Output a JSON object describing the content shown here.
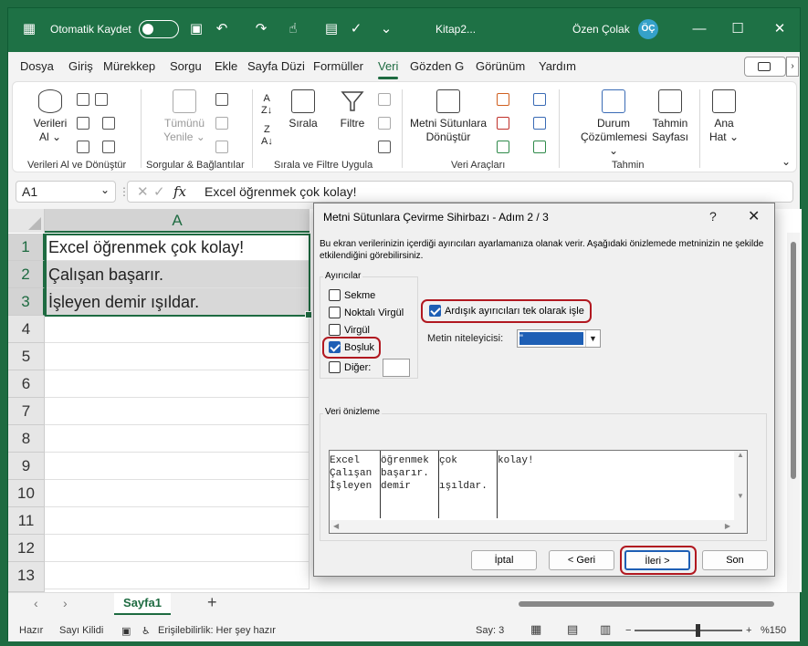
{
  "titlebar": {
    "autosave_label": "Otomatik Kaydet",
    "doc_title": "Kitap2...",
    "user_name": "Özen Çolak",
    "user_initials": "ÖÇ"
  },
  "menu": {
    "tabs": [
      "Dosya",
      "Giriş",
      "Mürekkep",
      "Sorgu",
      "Ekle",
      "Sayfa Düzi",
      "Formüller",
      "Veri",
      "Gözden G",
      "Görünüm",
      "Yardım"
    ],
    "active": "Veri"
  },
  "ribbon": {
    "get_data_label": "Verileri",
    "get_data_label2": "Al",
    "get_data_group": "Verileri Al ve Dönüştür",
    "refresh_label": "Tümünü",
    "refresh_label2": "Yenile",
    "queries_group": "Sorgular & Bağlantılar",
    "sort_label": "Sırala",
    "filter_label": "Filtre",
    "sort_filter_group": "Sırala ve Filtre Uygula",
    "text_to_columns_label": "Metni Sütunlara",
    "text_to_columns_label2": "Dönüştür",
    "data_tools_group": "Veri Araçları",
    "what_if_label": "Durum",
    "what_if_label2": "Çözümlemesi",
    "forecast_label": "Tahmin",
    "forecast_label2": "Sayfası",
    "forecast_group": "Tahmin",
    "outline_label": "Ana",
    "outline_label2": "Hat"
  },
  "formula_bar": {
    "name_box": "A1",
    "formula": "Excel öğrenmek çok kolay!"
  },
  "grid": {
    "column_header": "A",
    "rows": [
      "1",
      "2",
      "3",
      "4",
      "5",
      "6",
      "7",
      "8",
      "9",
      "10",
      "11",
      "12",
      "13"
    ],
    "cells": [
      "Excel öğrenmek çok kolay!",
      "Çalışan başarır.",
      "İşleyen demir ışıldar."
    ]
  },
  "sheets": {
    "active_tab": "Sayfa1"
  },
  "status": {
    "ready": "Hazır",
    "numlock": "Sayı Kilidi",
    "accessibility": "Erişilebilirlik: Her şey hazır",
    "count": "Say: 3",
    "zoom": "%150"
  },
  "dialog": {
    "title": "Metni Sütunlara Çevirme Sihirbazı - Adım 2 / 3",
    "help": "?",
    "description": "Bu ekran verilerinizin içerdiği ayırıcıları ayarlamanıza olanak verir. Aşağıdaki önizlemede metninizin ne şekilde etkilendiğini görebilirsiniz.",
    "delimiters_label": "Ayırıcılar",
    "delimiters": [
      {
        "label": "Sekme",
        "checked": false
      },
      {
        "label": "Noktalı Virgül",
        "checked": false
      },
      {
        "label": "Virgül",
        "checked": false
      },
      {
        "label": "Boşluk",
        "checked": true
      },
      {
        "label": "Diğer:",
        "checked": false
      }
    ],
    "consecutive_label": "Ardışık ayırıcıları tek olarak işle",
    "consecutive_checked": true,
    "qualifier_label": "Metin niteleyicisi:",
    "qualifier_value": "\"",
    "preview_label": "Veri önizleme",
    "preview_columns": [
      [
        "Excel",
        "Çalışan",
        "İşleyen"
      ],
      [
        "öğrenmek",
        "başarır.",
        "demir"
      ],
      [
        "çok",
        "",
        "ışıldar."
      ],
      [
        "kolay!",
        "",
        ""
      ]
    ],
    "buttons": {
      "cancel": "İptal",
      "back": "< Geri",
      "next": "İleri >",
      "finish": "Son"
    }
  }
}
